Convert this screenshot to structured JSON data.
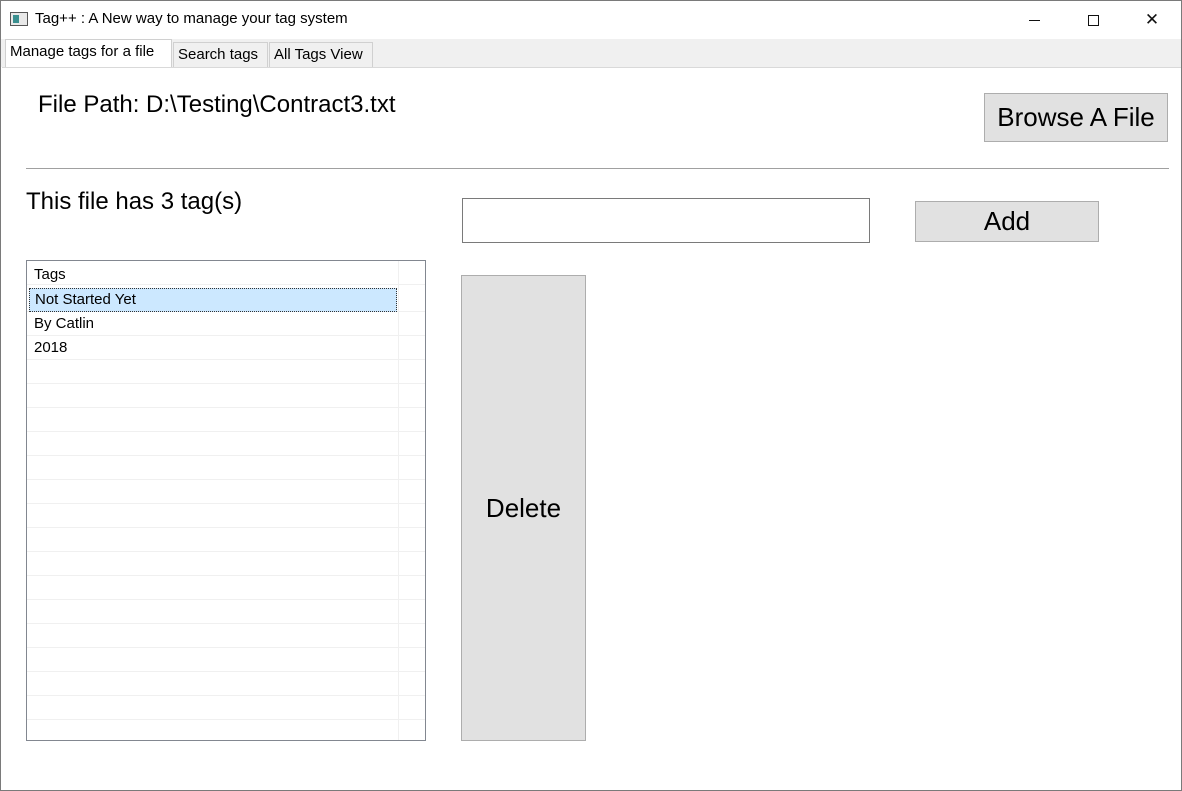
{
  "window": {
    "title": "Tag++ : A New way to manage your tag system",
    "controls": {
      "minimize": "minimize-icon",
      "maximize": "maximize-icon",
      "close": "✕"
    }
  },
  "tabs": [
    {
      "label": "Manage tags for a file",
      "active": true
    },
    {
      "label": "Search tags",
      "active": false
    },
    {
      "label": "All Tags View",
      "active": false
    }
  ],
  "file": {
    "path_label": "File Path: D:\\Testing\\Contract3.txt",
    "browse_label": "Browse A File"
  },
  "tags_section": {
    "count_label": "This file has 3 tag(s)",
    "input_value": "",
    "add_label": "Add",
    "delete_label": "Delete",
    "grid_header": "Tags",
    "rows": [
      "Not Started Yet",
      "By Catlin",
      "2018"
    ],
    "selected_index": 0
  },
  "colors": {
    "button_bg": "#e1e1e1",
    "selection": "#cce8ff",
    "tab_bar": "#f0f0f0"
  }
}
